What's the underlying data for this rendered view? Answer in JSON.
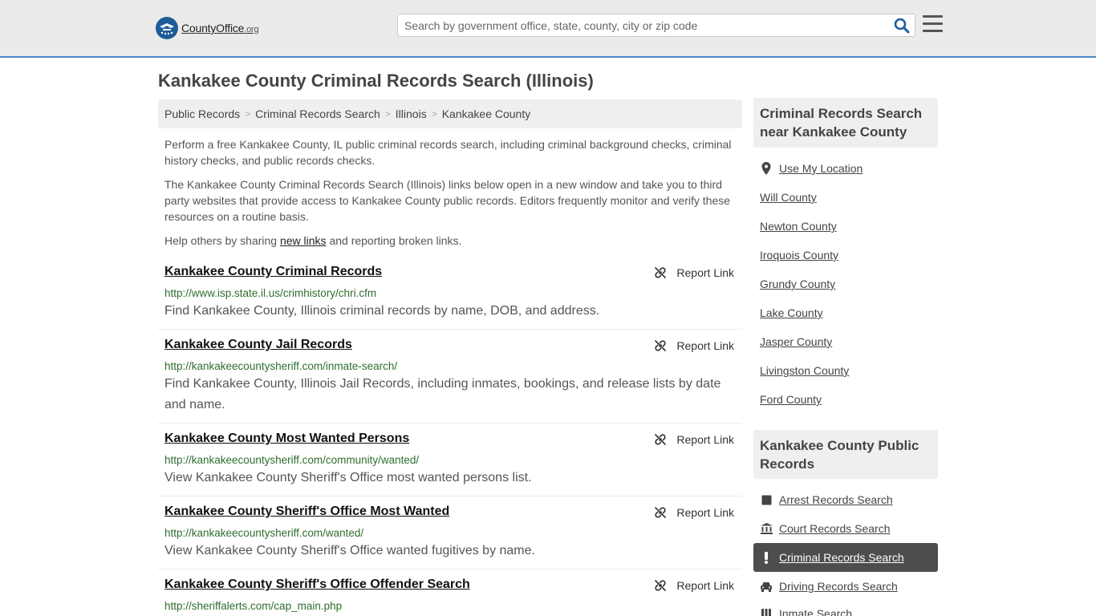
{
  "header": {
    "logo_text": "CountyOffice",
    "logo_tld": ".org",
    "search_placeholder": "Search by government office, state, county, city or zip code"
  },
  "page_title": "Kankakee County Criminal Records Search (Illinois)",
  "breadcrumb": [
    "Public Records",
    "Criminal Records Search",
    "Illinois",
    "Kankakee County"
  ],
  "intro": {
    "p1": "Perform a free Kankakee County, IL public criminal records search, including criminal background checks, criminal history checks, and public records checks.",
    "p2": "The Kankakee County Criminal Records Search (Illinois) links below open in a new window and take you to third party websites that provide access to Kankakee County public records. Editors frequently monitor and verify these resources on a routine basis.",
    "p3_before": "Help others by sharing ",
    "p3_link": "new links",
    "p3_after": " and reporting broken links."
  },
  "report_label": "Report Link",
  "records": [
    {
      "title": "Kankakee County Criminal Records",
      "url": "http://www.isp.state.il.us/crimhistory/chri.cfm",
      "desc": "Find Kankakee County, Illinois criminal records by name, DOB, and address."
    },
    {
      "title": "Kankakee County Jail Records",
      "url": "http://kankakeecountysheriff.com/inmate-search/",
      "desc": "Find Kankakee County, Illinois Jail Records, including inmates, bookings, and release lists by date and name."
    },
    {
      "title": "Kankakee County Most Wanted Persons",
      "url": "http://kankakeecountysheriff.com/community/wanted/",
      "desc": "View Kankakee County Sheriff's Office most wanted persons list."
    },
    {
      "title": "Kankakee County Sheriff's Office Most Wanted",
      "url": "http://kankakeecountysheriff.com/wanted/",
      "desc": "View Kankakee County Sheriff's Office wanted fugitives by name."
    },
    {
      "title": "Kankakee County Sheriff's Office Offender Search",
      "url": "http://sheriffalerts.com/cap_main.php",
      "desc": ""
    }
  ],
  "sidebar": {
    "nearby_title": "Criminal Records Search near Kankakee County",
    "use_location": "Use My Location",
    "nearby": [
      "Will County",
      "Newton County",
      "Iroquois County",
      "Grundy County",
      "Lake County",
      "Jasper County",
      "Livingston County",
      "Ford County"
    ],
    "public_title": "Kankakee County Public Records",
    "public_links": [
      {
        "label": "Arrest Records Search",
        "icon": "square-icon"
      },
      {
        "label": "Court Records Search",
        "icon": "courthouse-icon"
      },
      {
        "label": "Criminal Records Search",
        "icon": "exclamation-icon",
        "active": true
      },
      {
        "label": "Driving Records Search",
        "icon": "car-icon"
      },
      {
        "label": "Inmate Search",
        "icon": "inmate-icon"
      }
    ]
  },
  "colors": {
    "accent_border": "#4a86c5",
    "url_green": "#2f6e2f",
    "active_bg": "#4d4d4d"
  }
}
